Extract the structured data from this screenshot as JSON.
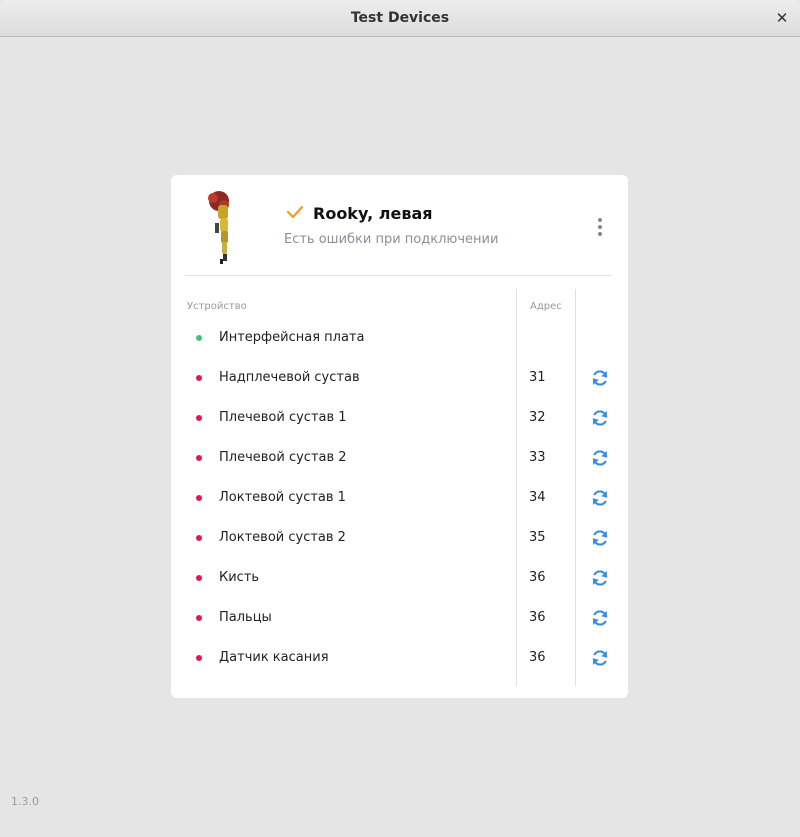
{
  "window": {
    "title": "Test Devices"
  },
  "device": {
    "name": "Rooky, левая",
    "status": "Есть ошибки при подключении",
    "status_icon": "checkmark-icon",
    "accent_color": "#f29b1f"
  },
  "table": {
    "headers": {
      "device": "Устройство",
      "address": "Адрес"
    },
    "rows": [
      {
        "name": "Интерфейсная плата",
        "address": "",
        "status": "ok",
        "refresh": false
      },
      {
        "name": "Надплечевой сустав",
        "address": "31",
        "status": "error",
        "refresh": true
      },
      {
        "name": "Плечевой сустав 1",
        "address": "32",
        "status": "error",
        "refresh": true
      },
      {
        "name": "Плечевой сустав 2",
        "address": "33",
        "status": "error",
        "refresh": true
      },
      {
        "name": "Локтевой сустав 1",
        "address": "34",
        "status": "error",
        "refresh": true
      },
      {
        "name": "Локтевой сустав 2",
        "address": "35",
        "status": "error",
        "refresh": true
      },
      {
        "name": "Кисть",
        "address": "36",
        "status": "error",
        "refresh": true
      },
      {
        "name": "Пальцы",
        "address": "36",
        "status": "error",
        "refresh": true
      },
      {
        "name": "Датчик касания",
        "address": "36",
        "status": "error",
        "refresh": true
      }
    ]
  },
  "colors": {
    "ok": "#3cc47c",
    "error": "#e8174a",
    "refresh": "#3a8ee6"
  },
  "footer": {
    "version": "1.3.0"
  }
}
